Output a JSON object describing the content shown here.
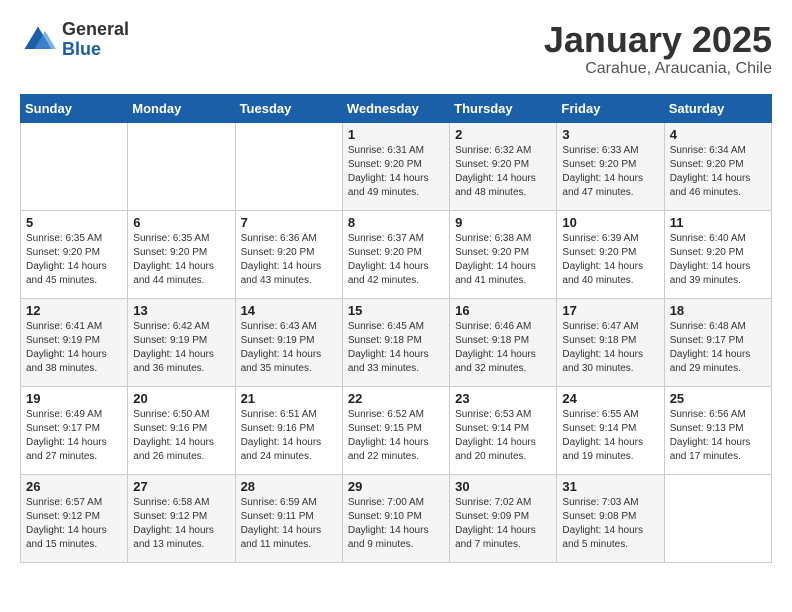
{
  "logo": {
    "general": "General",
    "blue": "Blue"
  },
  "title": "January 2025",
  "subtitle": "Carahue, Araucania, Chile",
  "weekdays": [
    "Sunday",
    "Monday",
    "Tuesday",
    "Wednesday",
    "Thursday",
    "Friday",
    "Saturday"
  ],
  "weeks": [
    [
      {
        "day": "",
        "info": ""
      },
      {
        "day": "",
        "info": ""
      },
      {
        "day": "",
        "info": ""
      },
      {
        "day": "1",
        "info": "Sunrise: 6:31 AM\nSunset: 9:20 PM\nDaylight: 14 hours\nand 49 minutes."
      },
      {
        "day": "2",
        "info": "Sunrise: 6:32 AM\nSunset: 9:20 PM\nDaylight: 14 hours\nand 48 minutes."
      },
      {
        "day": "3",
        "info": "Sunrise: 6:33 AM\nSunset: 9:20 PM\nDaylight: 14 hours\nand 47 minutes."
      },
      {
        "day": "4",
        "info": "Sunrise: 6:34 AM\nSunset: 9:20 PM\nDaylight: 14 hours\nand 46 minutes."
      }
    ],
    [
      {
        "day": "5",
        "info": "Sunrise: 6:35 AM\nSunset: 9:20 PM\nDaylight: 14 hours\nand 45 minutes."
      },
      {
        "day": "6",
        "info": "Sunrise: 6:35 AM\nSunset: 9:20 PM\nDaylight: 14 hours\nand 44 minutes."
      },
      {
        "day": "7",
        "info": "Sunrise: 6:36 AM\nSunset: 9:20 PM\nDaylight: 14 hours\nand 43 minutes."
      },
      {
        "day": "8",
        "info": "Sunrise: 6:37 AM\nSunset: 9:20 PM\nDaylight: 14 hours\nand 42 minutes."
      },
      {
        "day": "9",
        "info": "Sunrise: 6:38 AM\nSunset: 9:20 PM\nDaylight: 14 hours\nand 41 minutes."
      },
      {
        "day": "10",
        "info": "Sunrise: 6:39 AM\nSunset: 9:20 PM\nDaylight: 14 hours\nand 40 minutes."
      },
      {
        "day": "11",
        "info": "Sunrise: 6:40 AM\nSunset: 9:20 PM\nDaylight: 14 hours\nand 39 minutes."
      }
    ],
    [
      {
        "day": "12",
        "info": "Sunrise: 6:41 AM\nSunset: 9:19 PM\nDaylight: 14 hours\nand 38 minutes."
      },
      {
        "day": "13",
        "info": "Sunrise: 6:42 AM\nSunset: 9:19 PM\nDaylight: 14 hours\nand 36 minutes."
      },
      {
        "day": "14",
        "info": "Sunrise: 6:43 AM\nSunset: 9:19 PM\nDaylight: 14 hours\nand 35 minutes."
      },
      {
        "day": "15",
        "info": "Sunrise: 6:45 AM\nSunset: 9:18 PM\nDaylight: 14 hours\nand 33 minutes."
      },
      {
        "day": "16",
        "info": "Sunrise: 6:46 AM\nSunset: 9:18 PM\nDaylight: 14 hours\nand 32 minutes."
      },
      {
        "day": "17",
        "info": "Sunrise: 6:47 AM\nSunset: 9:18 PM\nDaylight: 14 hours\nand 30 minutes."
      },
      {
        "day": "18",
        "info": "Sunrise: 6:48 AM\nSunset: 9:17 PM\nDaylight: 14 hours\nand 29 minutes."
      }
    ],
    [
      {
        "day": "19",
        "info": "Sunrise: 6:49 AM\nSunset: 9:17 PM\nDaylight: 14 hours\nand 27 minutes."
      },
      {
        "day": "20",
        "info": "Sunrise: 6:50 AM\nSunset: 9:16 PM\nDaylight: 14 hours\nand 26 minutes."
      },
      {
        "day": "21",
        "info": "Sunrise: 6:51 AM\nSunset: 9:16 PM\nDaylight: 14 hours\nand 24 minutes."
      },
      {
        "day": "22",
        "info": "Sunrise: 6:52 AM\nSunset: 9:15 PM\nDaylight: 14 hours\nand 22 minutes."
      },
      {
        "day": "23",
        "info": "Sunrise: 6:53 AM\nSunset: 9:14 PM\nDaylight: 14 hours\nand 20 minutes."
      },
      {
        "day": "24",
        "info": "Sunrise: 6:55 AM\nSunset: 9:14 PM\nDaylight: 14 hours\nand 19 minutes."
      },
      {
        "day": "25",
        "info": "Sunrise: 6:56 AM\nSunset: 9:13 PM\nDaylight: 14 hours\nand 17 minutes."
      }
    ],
    [
      {
        "day": "26",
        "info": "Sunrise: 6:57 AM\nSunset: 9:12 PM\nDaylight: 14 hours\nand 15 minutes."
      },
      {
        "day": "27",
        "info": "Sunrise: 6:58 AM\nSunset: 9:12 PM\nDaylight: 14 hours\nand 13 minutes."
      },
      {
        "day": "28",
        "info": "Sunrise: 6:59 AM\nSunset: 9:11 PM\nDaylight: 14 hours\nand 11 minutes."
      },
      {
        "day": "29",
        "info": "Sunrise: 7:00 AM\nSunset: 9:10 PM\nDaylight: 14 hours\nand 9 minutes."
      },
      {
        "day": "30",
        "info": "Sunrise: 7:02 AM\nSunset: 9:09 PM\nDaylight: 14 hours\nand 7 minutes."
      },
      {
        "day": "31",
        "info": "Sunrise: 7:03 AM\nSunset: 9:08 PM\nDaylight: 14 hours\nand 5 minutes."
      },
      {
        "day": "",
        "info": ""
      }
    ]
  ]
}
